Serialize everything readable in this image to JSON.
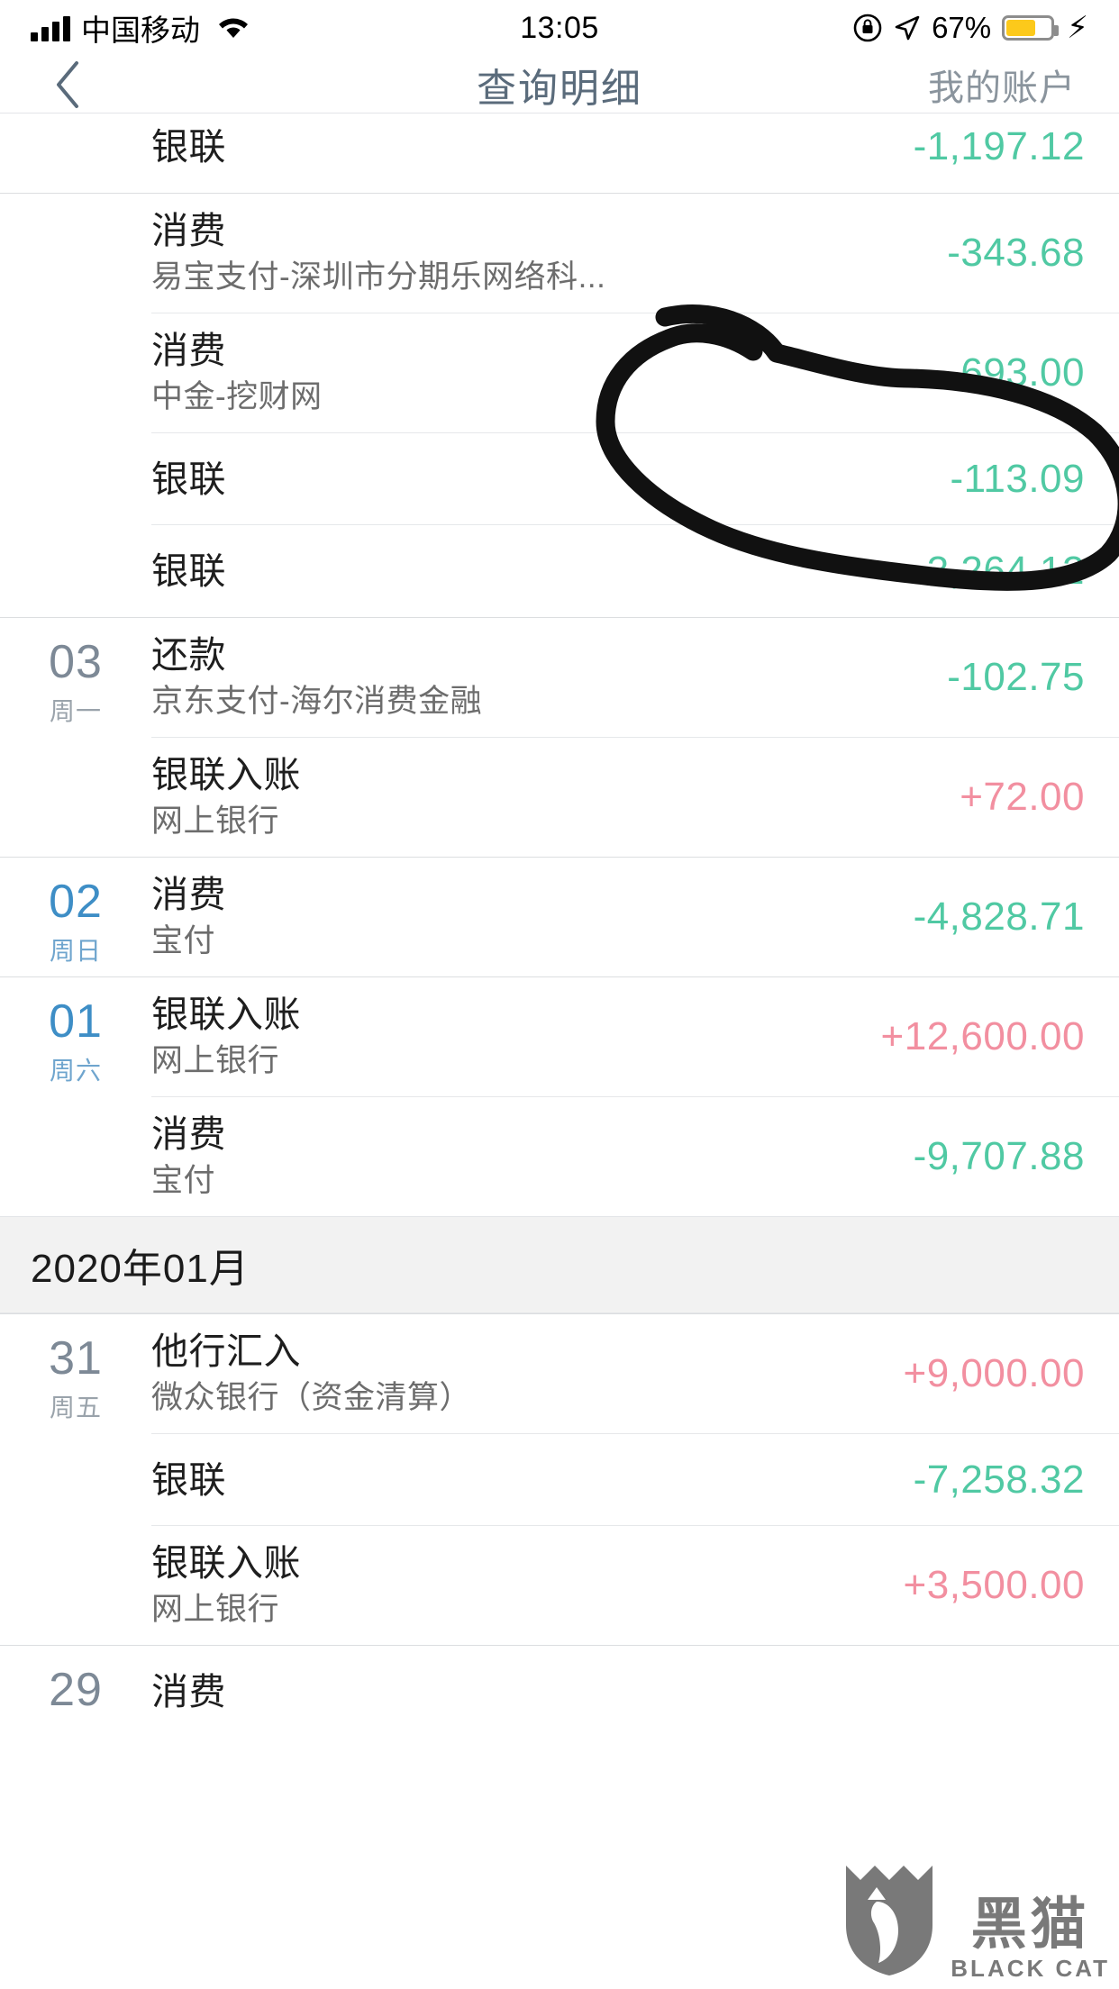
{
  "status_bar": {
    "carrier": "中国移动",
    "time": "13:05",
    "battery_percent": "67%",
    "icons": [
      "signal-bars-icon",
      "wifi-icon",
      "rotation-lock-icon",
      "location-arrow-icon",
      "battery-icon",
      "charging-bolt-icon"
    ]
  },
  "nav": {
    "back_icon": "chevron-left-icon",
    "title": "查询明细",
    "right_link": "我的账户"
  },
  "colors": {
    "negative_amount": "#50C9A3",
    "positive_amount": "#F28FA0",
    "nav_title": "#5A6B7B",
    "weekend_date": "#3E8EC6",
    "weekday_date": "#7D8996",
    "annotation": "#000000"
  },
  "annotation": {
    "type": "hand-drawn-circle",
    "note": "黑色手绘圈注记"
  },
  "watermark": {
    "cn": "黑猫",
    "en": "BLACK CAT",
    "icon": "cat-shield-icon"
  },
  "groups": [
    {
      "date": null,
      "weekday": null,
      "clipped": true,
      "rows": [
        {
          "title": "银联",
          "sub": "",
          "amount": "-1,197.12",
          "sign": "neg"
        }
      ]
    },
    {
      "date": null,
      "weekday": null,
      "rows": [
        {
          "title": "消费",
          "sub": "易宝支付-深圳市分期乐网络科...",
          "amount": "-343.68",
          "sign": "neg"
        },
        {
          "title": "消费",
          "sub": "中金-挖财网",
          "amount": "-693.00",
          "sign": "neg"
        },
        {
          "title": "银联",
          "sub": "",
          "amount": "-113.09",
          "sign": "neg"
        },
        {
          "title": "银联",
          "sub": "",
          "amount": "-3,264.12",
          "sign": "neg"
        }
      ]
    },
    {
      "date": "03",
      "weekday": "周一",
      "weekend": false,
      "rows": [
        {
          "title": "还款",
          "sub": "京东支付-海尔消费金融",
          "amount": "-102.75",
          "sign": "neg"
        },
        {
          "title": "银联入账",
          "sub": "网上银行",
          "amount": "+72.00",
          "sign": "pos"
        }
      ]
    },
    {
      "date": "02",
      "weekday": "周日",
      "weekend": true,
      "rows": [
        {
          "title": "消费",
          "sub": "宝付",
          "amount": "-4,828.71",
          "sign": "neg"
        }
      ]
    },
    {
      "date": "01",
      "weekday": "周六",
      "weekend": true,
      "rows": [
        {
          "title": "银联入账",
          "sub": "网上银行",
          "amount": "+12,600.00",
          "sign": "pos"
        },
        {
          "title": "消费",
          "sub": "宝付",
          "amount": "-9,707.88",
          "sign": "neg"
        }
      ]
    }
  ],
  "month_header": "2020年01月",
  "groups2": [
    {
      "date": "31",
      "weekday": "周五",
      "weekend": false,
      "rows": [
        {
          "title": "他行汇入",
          "sub": "微众银行（资金清算）",
          "amount": "+9,000.00",
          "sign": "pos"
        },
        {
          "title": "银联",
          "sub": "",
          "amount": "-7,258.32",
          "sign": "neg"
        },
        {
          "title": "银联入账",
          "sub": "网上银行",
          "amount": "+3,500.00",
          "sign": "pos"
        }
      ]
    },
    {
      "date": "29",
      "weekday": "",
      "weekend": false,
      "clipped_bottom": true,
      "rows": [
        {
          "title": "消费",
          "sub": "",
          "amount": "",
          "sign": "neg"
        }
      ]
    }
  ]
}
